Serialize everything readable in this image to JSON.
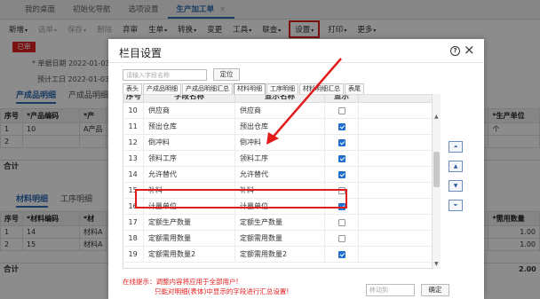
{
  "app": {
    "tabs": [
      {
        "label": "我的桌面"
      },
      {
        "label": "初始化导航"
      },
      {
        "label": "选项设置"
      },
      {
        "label": "生产加工单",
        "close": "×"
      }
    ],
    "toolbar": {
      "items": [
        {
          "label": "新增",
          "caret": "▾"
        },
        {
          "label": "选单",
          "caret": "▾"
        },
        {
          "label": "保存",
          "caret": "▾"
        },
        {
          "label": "删除"
        },
        {
          "label": "弃审"
        },
        {
          "label": "生单",
          "caret": "▾"
        },
        {
          "label": "转换",
          "caret": "▾"
        },
        {
          "label": "变更"
        },
        {
          "label": "工具",
          "caret": "▾"
        },
        {
          "label": "联查",
          "caret": "▾"
        },
        {
          "label": "设置",
          "caret": "▾"
        },
        {
          "label": "打印",
          "caret": "▾"
        },
        {
          "label": "更多",
          "caret": "▾"
        }
      ]
    },
    "status_badge": "已审",
    "fields": [
      {
        "label": "* 单据日期",
        "value": "2022-01-03"
      },
      {
        "label": "预计工日",
        "value": "2022-01-03"
      }
    ],
    "product_tabs": [
      "产成品明细",
      "产成品明细"
    ],
    "product_table": {
      "headers": [
        "序号",
        "*产品编码",
        "*产"
      ],
      "right_header": "*生产单位",
      "rows": [
        {
          "no": "1",
          "code": "10",
          "name": "A产品",
          "unit": "个"
        },
        {
          "no": "2",
          "code": "",
          "name": "",
          "unit": ""
        }
      ]
    },
    "sum_label": "合计",
    "material_tabs": [
      "材料明细",
      "工序明细"
    ],
    "material_table": {
      "headers": [
        "序号",
        "*材料编码",
        "*材"
      ],
      "right_header": "*需用数量",
      "rows": [
        {
          "no": "1",
          "code": "14",
          "name": "材料A",
          "qty": "1.00"
        },
        {
          "no": "2",
          "code": "15",
          "name": "材料A",
          "qty": "1.00"
        }
      ],
      "sum_value": "2.00"
    }
  },
  "dialog": {
    "title": "栏目设置",
    "help": "?",
    "close": "×",
    "search_placeholder": "请输入字段名称",
    "locate_label": "定位",
    "tabs": [
      "表头",
      "产成品明细",
      "产成品明细汇总",
      "材料明细",
      "工序明细",
      "材料明细汇总",
      "表尾"
    ],
    "active_tab": "材料明细",
    "columns": [
      "序号",
      "字段名称",
      "显示名称",
      "显示"
    ],
    "rows": [
      {
        "no": "10",
        "field": "供应商",
        "display": "供应商",
        "show": false
      },
      {
        "no": "11",
        "field": "预出仓库",
        "display": "预出仓库",
        "show": true
      },
      {
        "no": "12",
        "field": "倒冲料",
        "display": "倒冲料",
        "show": true
      },
      {
        "no": "13",
        "field": "领料工序",
        "display": "领料工序",
        "show": true
      },
      {
        "no": "14",
        "field": "允许替代",
        "display": "允许替代",
        "show": true
      },
      {
        "no": "15",
        "field": "补料",
        "display": "补料",
        "show": false
      },
      {
        "no": "16",
        "field": "计量单位",
        "display": "计量单位",
        "show": true
      },
      {
        "no": "17",
        "field": "定额生产数量",
        "display": "定额生产数量",
        "show": false
      },
      {
        "no": "18",
        "field": "定额需用数量",
        "display": "定额需用数量",
        "show": false
      },
      {
        "no": "19",
        "field": "定额需用数量2",
        "display": "定额需用数量2",
        "show": true
      }
    ],
    "move_buttons": [
      "⏶",
      "▲",
      "▼",
      "⏷"
    ],
    "tip_line1": "在线提示：调整内容将应用于全部用户!",
    "tip_line2": "只能对明细(表体)中显示的字段进行汇总设置!",
    "move_to_placeholder": "移动到",
    "ok_label": "确定"
  },
  "colors": {
    "accent": "#2f6db5",
    "highlight": "#e21b1b",
    "checkbox": "#1f6fd1"
  }
}
